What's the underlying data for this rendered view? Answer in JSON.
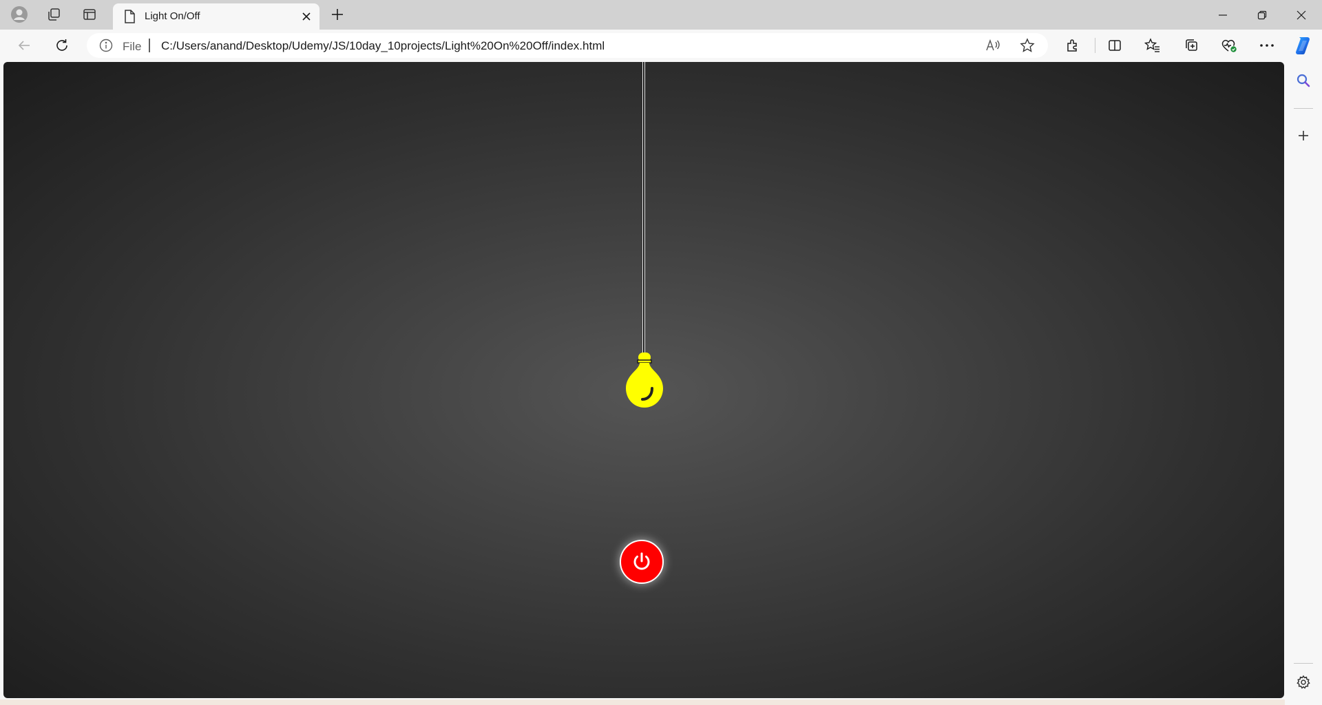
{
  "tab": {
    "title": "Light On/Off"
  },
  "address_bar": {
    "scheme_label": "File",
    "url": "C:/Users/anand/Desktop/Udemy/JS/10day_10projects/Light%20On%20Off/index.html"
  },
  "page": {
    "background_center": "#555555",
    "background_edge": "#1c1c1c",
    "bulb_color": "#ffff00",
    "power_button_color": "#ff0000",
    "power_icon": "power-icon"
  },
  "colors": {
    "tab_strip": "#d2d2d2",
    "chrome": "#f7f7f7",
    "copilot_accent": "#1f6feb"
  }
}
